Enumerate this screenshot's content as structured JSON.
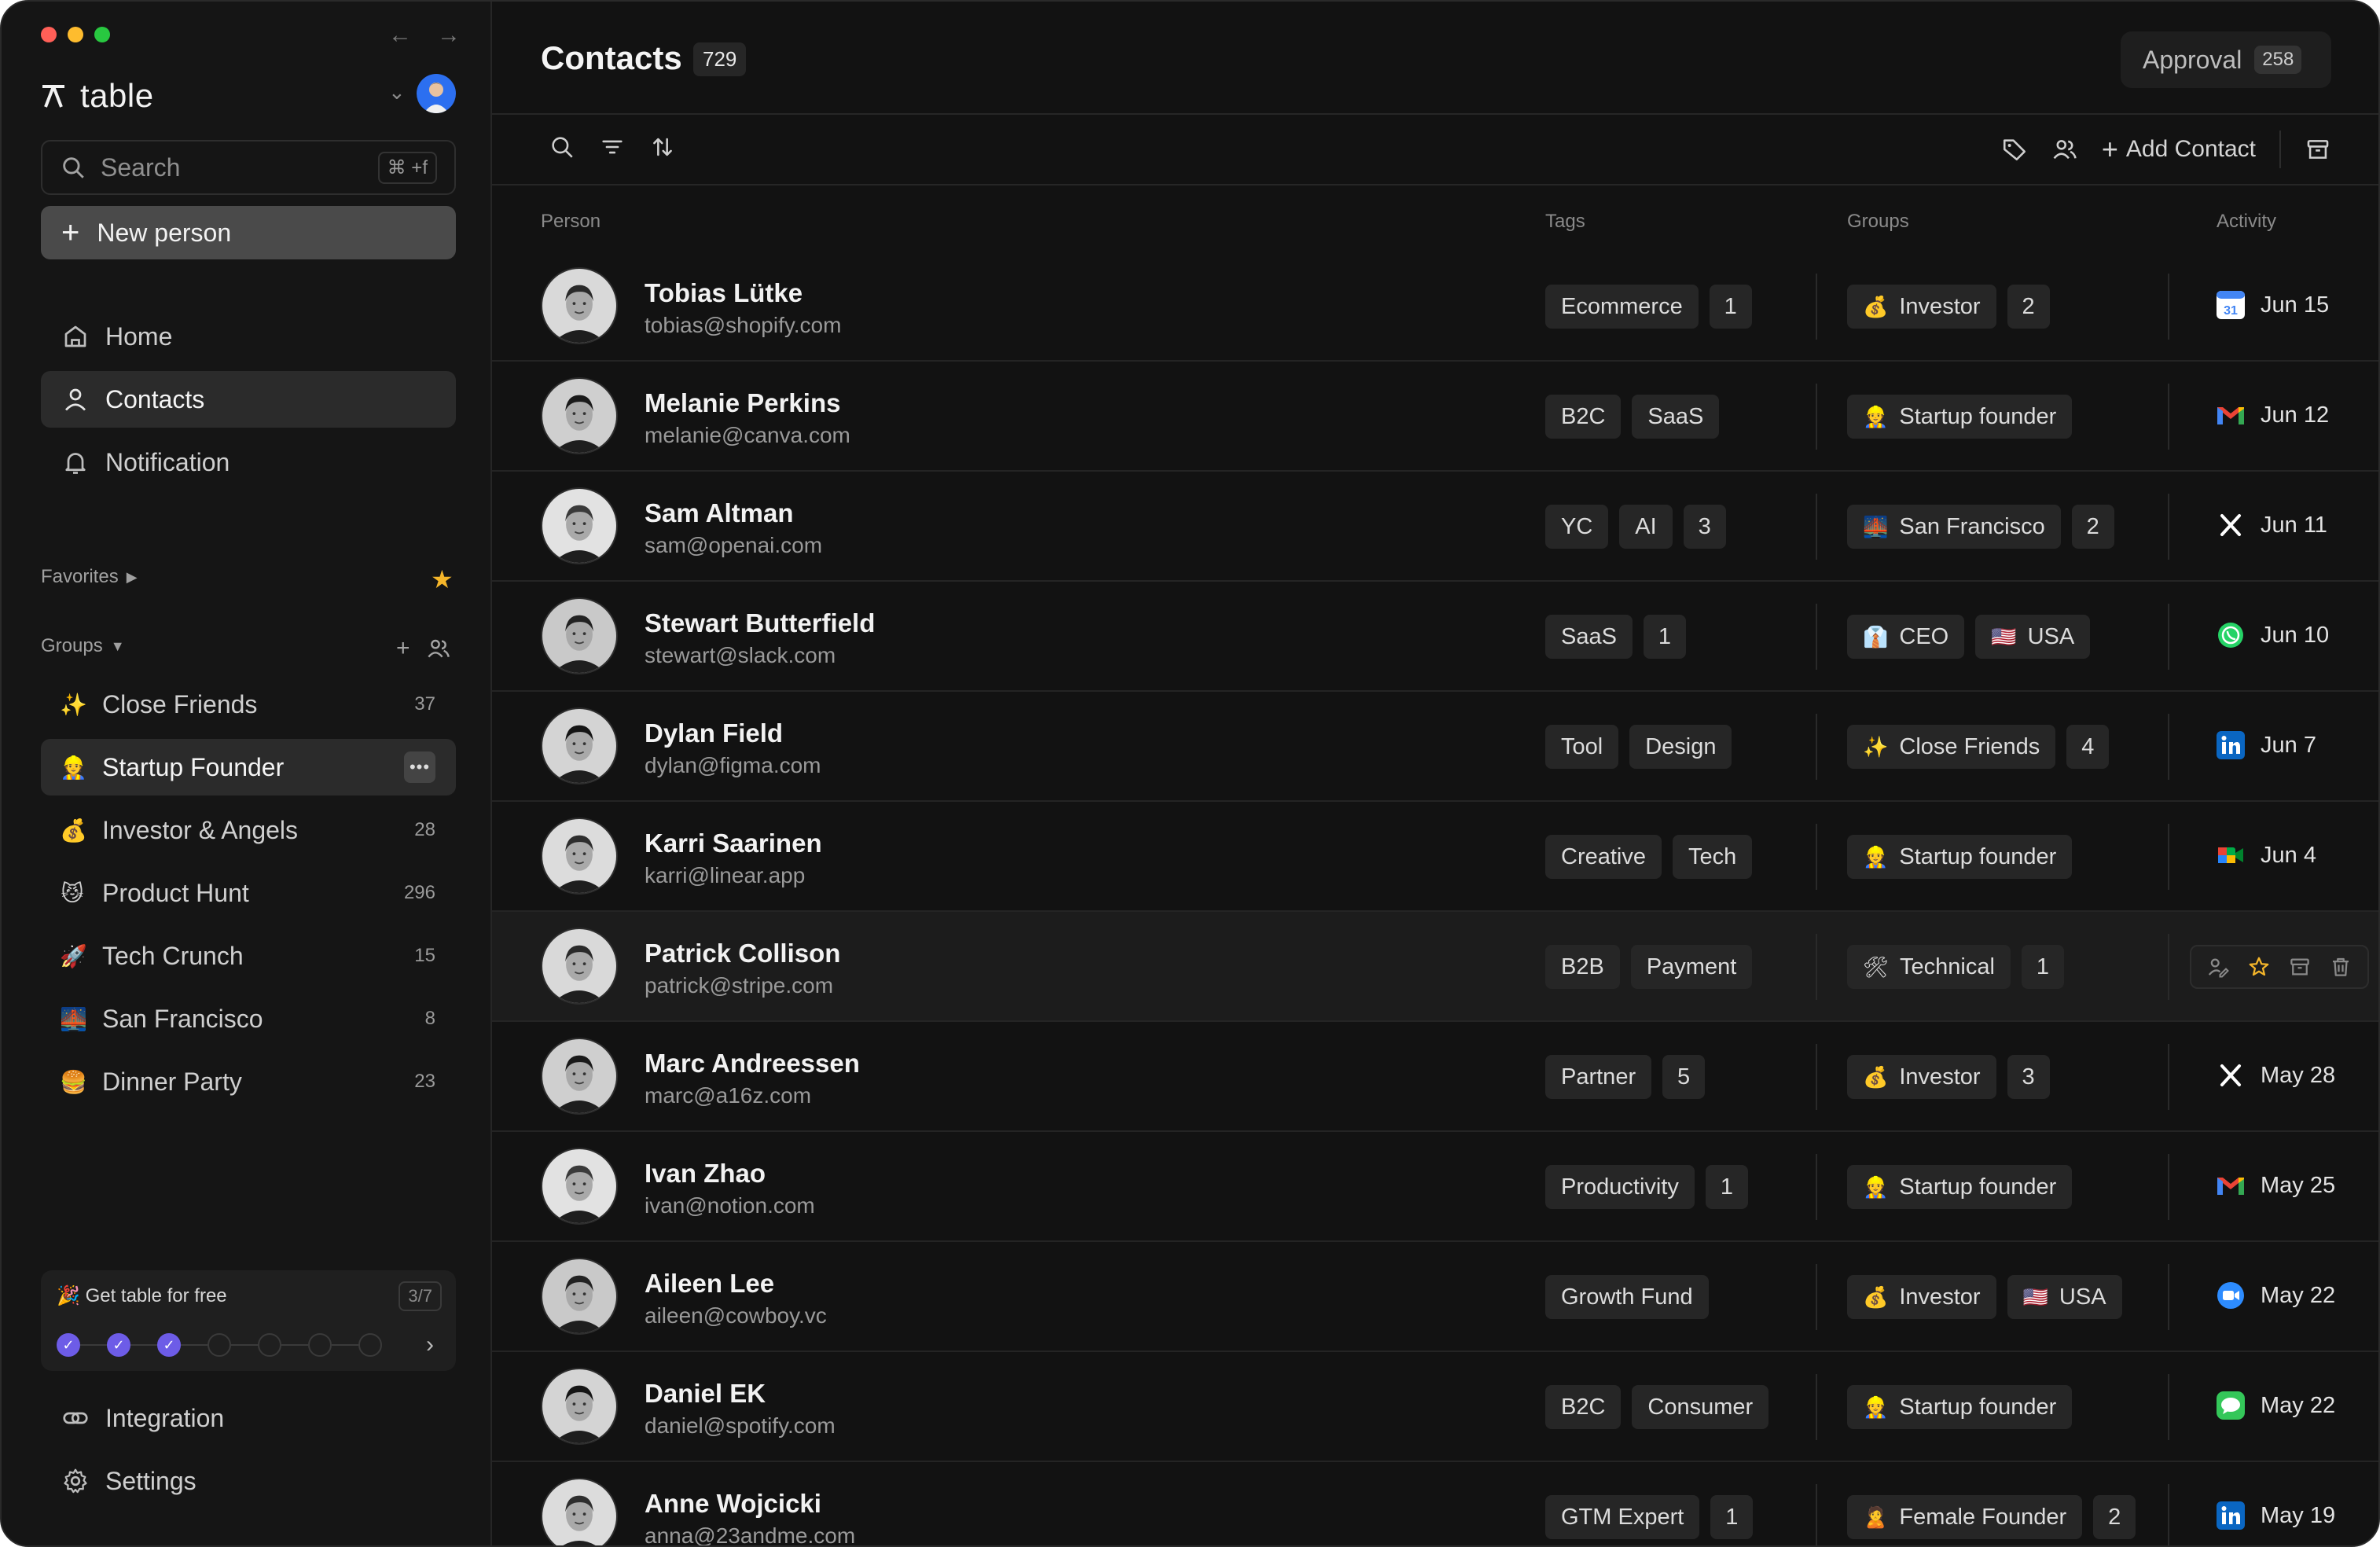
{
  "app": {
    "name": "table"
  },
  "sidebar": {
    "search": {
      "placeholder": "Search",
      "shortcut": "⌘ +f"
    },
    "new_person_label": "New person",
    "nav": [
      {
        "label": "Home",
        "icon": "home-icon"
      },
      {
        "label": "Contacts",
        "icon": "user-icon",
        "active": true
      },
      {
        "label": "Notification",
        "icon": "bell-icon"
      }
    ],
    "favorites_label": "Favorites",
    "groups_label": "Groups",
    "groups": [
      {
        "emoji": "✨",
        "name": "Close Friends",
        "count": "37"
      },
      {
        "emoji": "👷",
        "name": "Startup Founder",
        "count": "",
        "active": true
      },
      {
        "emoji": "💰",
        "name": "Investor & Angels",
        "count": "28"
      },
      {
        "emoji": "😼",
        "name": "Product Hunt",
        "count": "296"
      },
      {
        "emoji": "🚀",
        "name": "Tech Crunch",
        "count": "15"
      },
      {
        "emoji": "🌉",
        "name": "San Francisco",
        "count": "8"
      },
      {
        "emoji": "🍔",
        "name": "Dinner Party",
        "count": "23"
      }
    ],
    "promo": {
      "emoji": "🎉",
      "title": "Get table for free",
      "progress": "3/7",
      "steps_done": 3,
      "steps_total": 7
    },
    "bottom": [
      {
        "label": "Integration",
        "icon": "link-icon"
      },
      {
        "label": "Settings",
        "icon": "gear-icon"
      }
    ]
  },
  "main": {
    "title": "Contacts",
    "count": "729",
    "approval": {
      "label": "Approval",
      "count": "258"
    },
    "toolbar": {
      "add_contact": "Add Contact"
    },
    "columns": {
      "person": "Person",
      "tags": "Tags",
      "groups": "Groups",
      "activity": "Activity"
    },
    "contacts": [
      {
        "name": "Tobias Lütke",
        "email": "tobias@shopify.com",
        "tags": [
          "Ecommerce",
          "1"
        ],
        "groups": [
          [
            "💰",
            "Investor"
          ],
          [
            "",
            "2"
          ]
        ],
        "activity": {
          "icon": "calendar",
          "date": "Jun 15"
        }
      },
      {
        "name": "Melanie Perkins",
        "email": "melanie@canva.com",
        "tags": [
          "B2C",
          "SaaS"
        ],
        "groups": [
          [
            "👷",
            "Startup founder"
          ]
        ],
        "activity": {
          "icon": "gmail",
          "date": "Jun 12"
        }
      },
      {
        "name": "Sam Altman",
        "email": "sam@openai.com",
        "tags": [
          "YC",
          "AI",
          "3"
        ],
        "groups": [
          [
            "🌉",
            "San Francisco"
          ],
          [
            "",
            "2"
          ]
        ],
        "activity": {
          "icon": "x",
          "date": "Jun 11"
        }
      },
      {
        "name": "Stewart Butterfield",
        "email": "stewart@slack.com",
        "tags": [
          "SaaS",
          "1"
        ],
        "groups": [
          [
            "👔",
            "CEO"
          ],
          [
            "🇺🇸",
            "USA"
          ]
        ],
        "activity": {
          "icon": "whatsapp",
          "date": "Jun 10"
        }
      },
      {
        "name": "Dylan Field",
        "email": "dylan@figma.com",
        "tags": [
          "Tool",
          "Design"
        ],
        "groups": [
          [
            "✨",
            "Close Friends"
          ],
          [
            "",
            "4"
          ]
        ],
        "activity": {
          "icon": "linkedin",
          "date": "Jun 7"
        }
      },
      {
        "name": "Karri Saarinen",
        "email": "karri@linear.app",
        "tags": [
          "Creative",
          "Tech"
        ],
        "groups": [
          [
            "👷",
            "Startup founder"
          ]
        ],
        "activity": {
          "icon": "meet",
          "date": "Jun 4"
        }
      },
      {
        "name": "Patrick Collison",
        "email": "patrick@stripe.com",
        "tags": [
          "B2B",
          "Payment"
        ],
        "groups": [
          [
            "🛠",
            "Technical"
          ],
          [
            "",
            "1"
          ]
        ],
        "activity": {
          "icon": "",
          "date": ""
        },
        "hover": true
      },
      {
        "name": "Marc Andreessen",
        "email": "marc@a16z.com",
        "tags": [
          "Partner",
          "5"
        ],
        "groups": [
          [
            "💰",
            "Investor"
          ],
          [
            "",
            "3"
          ]
        ],
        "activity": {
          "icon": "x",
          "date": "May 28"
        }
      },
      {
        "name": "Ivan Zhao",
        "email": "ivan@notion.com",
        "tags": [
          "Productivity",
          "1"
        ],
        "groups": [
          [
            "👷",
            "Startup founder"
          ]
        ],
        "activity": {
          "icon": "gmail",
          "date": "May 25"
        }
      },
      {
        "name": "Aileen Lee",
        "email": "aileen@cowboy.vc",
        "tags": [
          "Growth Fund"
        ],
        "groups": [
          [
            "💰",
            "Investor"
          ],
          [
            "🇺🇸",
            "USA"
          ]
        ],
        "activity": {
          "icon": "zoom",
          "date": "May 22"
        }
      },
      {
        "name": "Daniel EK",
        "email": "daniel@spotify.com",
        "tags": [
          "B2C",
          "Consumer"
        ],
        "groups": [
          [
            "👷",
            "Startup founder"
          ]
        ],
        "activity": {
          "icon": "messages",
          "date": "May 22"
        }
      },
      {
        "name": "Anne Wojcicki",
        "email": "anna@23andme.com",
        "tags": [
          "GTM Expert",
          "1"
        ],
        "groups": [
          [
            "🙎",
            "Female Founder"
          ],
          [
            "",
            "2"
          ]
        ],
        "activity": {
          "icon": "linkedin",
          "date": "May 19"
        }
      }
    ]
  },
  "colors": {
    "accent": "#6d5ce7",
    "star": "#f5b62a",
    "background": "#141414"
  }
}
